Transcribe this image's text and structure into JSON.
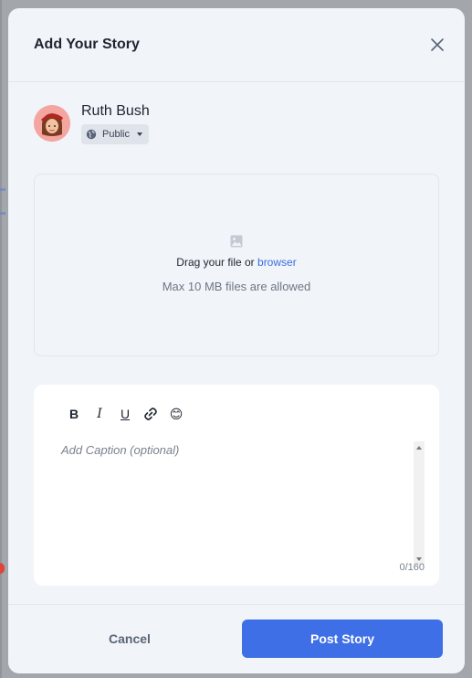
{
  "modal": {
    "title": "Add Your Story"
  },
  "user": {
    "name": "Ruth Bush",
    "privacy": "Public"
  },
  "upload": {
    "drag_text": "Drag your file or",
    "browse_label": "browser",
    "hint": "Max 10 MB files are allowed"
  },
  "editor": {
    "toolbar": {
      "bold": "B",
      "italic": "I",
      "underline": "U",
      "emoji": "😊"
    },
    "placeholder": "Add Caption (optional)",
    "char_count": "0/160"
  },
  "footer": {
    "cancel_label": "Cancel",
    "post_label": "Post Story"
  },
  "colors": {
    "accent": "#3e6fe6",
    "link": "#3b6ee0",
    "modal_bg": "#f1f4f8",
    "avatar_bg": "#f4a5a0"
  },
  "icons": [
    "close-icon",
    "avatar",
    "globe-icon",
    "caret-down-icon",
    "image-icon",
    "bold-icon",
    "italic-icon",
    "underline-icon",
    "link-icon",
    "emoji-icon"
  ]
}
